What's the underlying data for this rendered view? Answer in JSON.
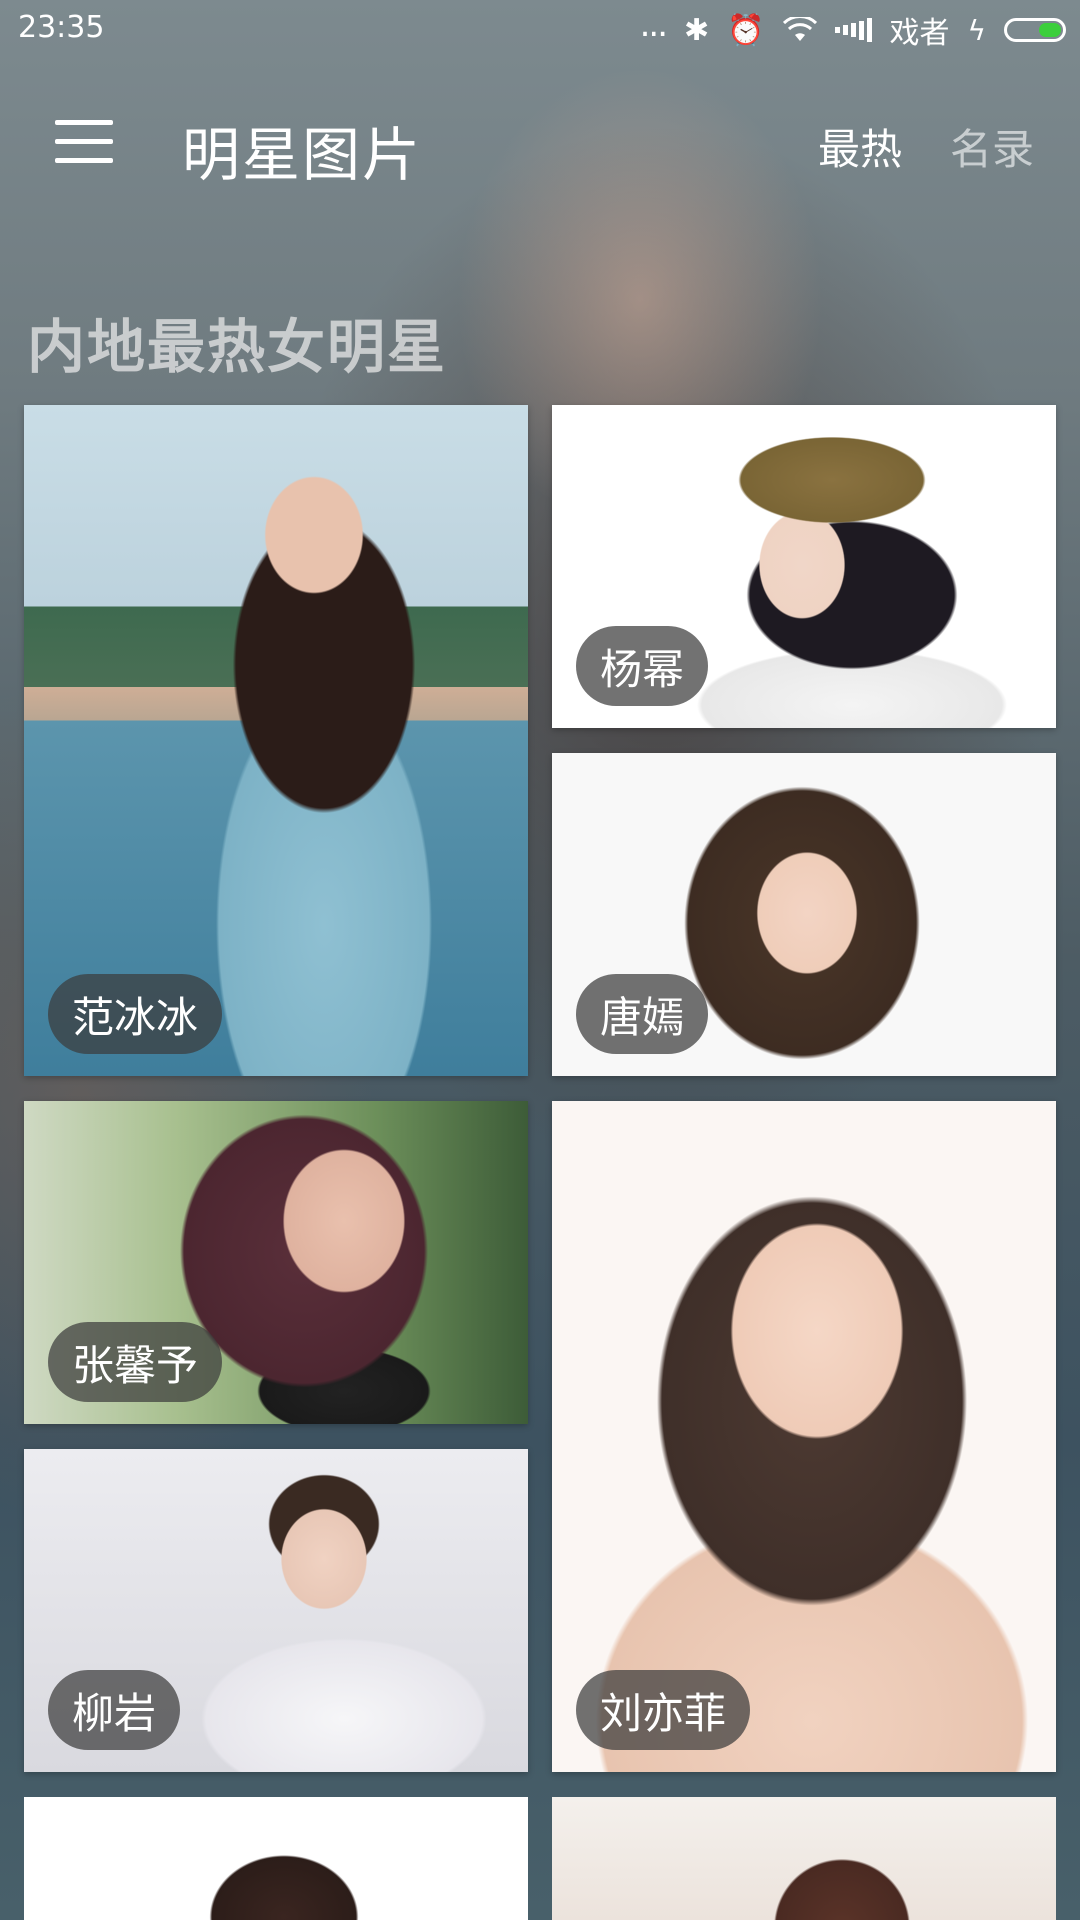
{
  "status_bar": {
    "time": "23:35",
    "more": "...",
    "carrier": "戏者",
    "icons": [
      "bluetooth-icon",
      "alarm-icon",
      "wifi-icon",
      "signal-icon",
      "charging-icon",
      "battery-icon"
    ],
    "battery_color": "#3ccf3c"
  },
  "app_bar": {
    "title": "明星图片",
    "tabs": [
      {
        "label": "最热",
        "active": true
      },
      {
        "label": "名录",
        "active": false
      }
    ]
  },
  "section": {
    "title": "内地最热女明星"
  },
  "stars": [
    {
      "name": "范冰冰"
    },
    {
      "name": "杨幂"
    },
    {
      "name": "唐嫣"
    },
    {
      "name": "张馨予"
    },
    {
      "name": "柳岩"
    },
    {
      "name": "刘亦菲"
    }
  ]
}
